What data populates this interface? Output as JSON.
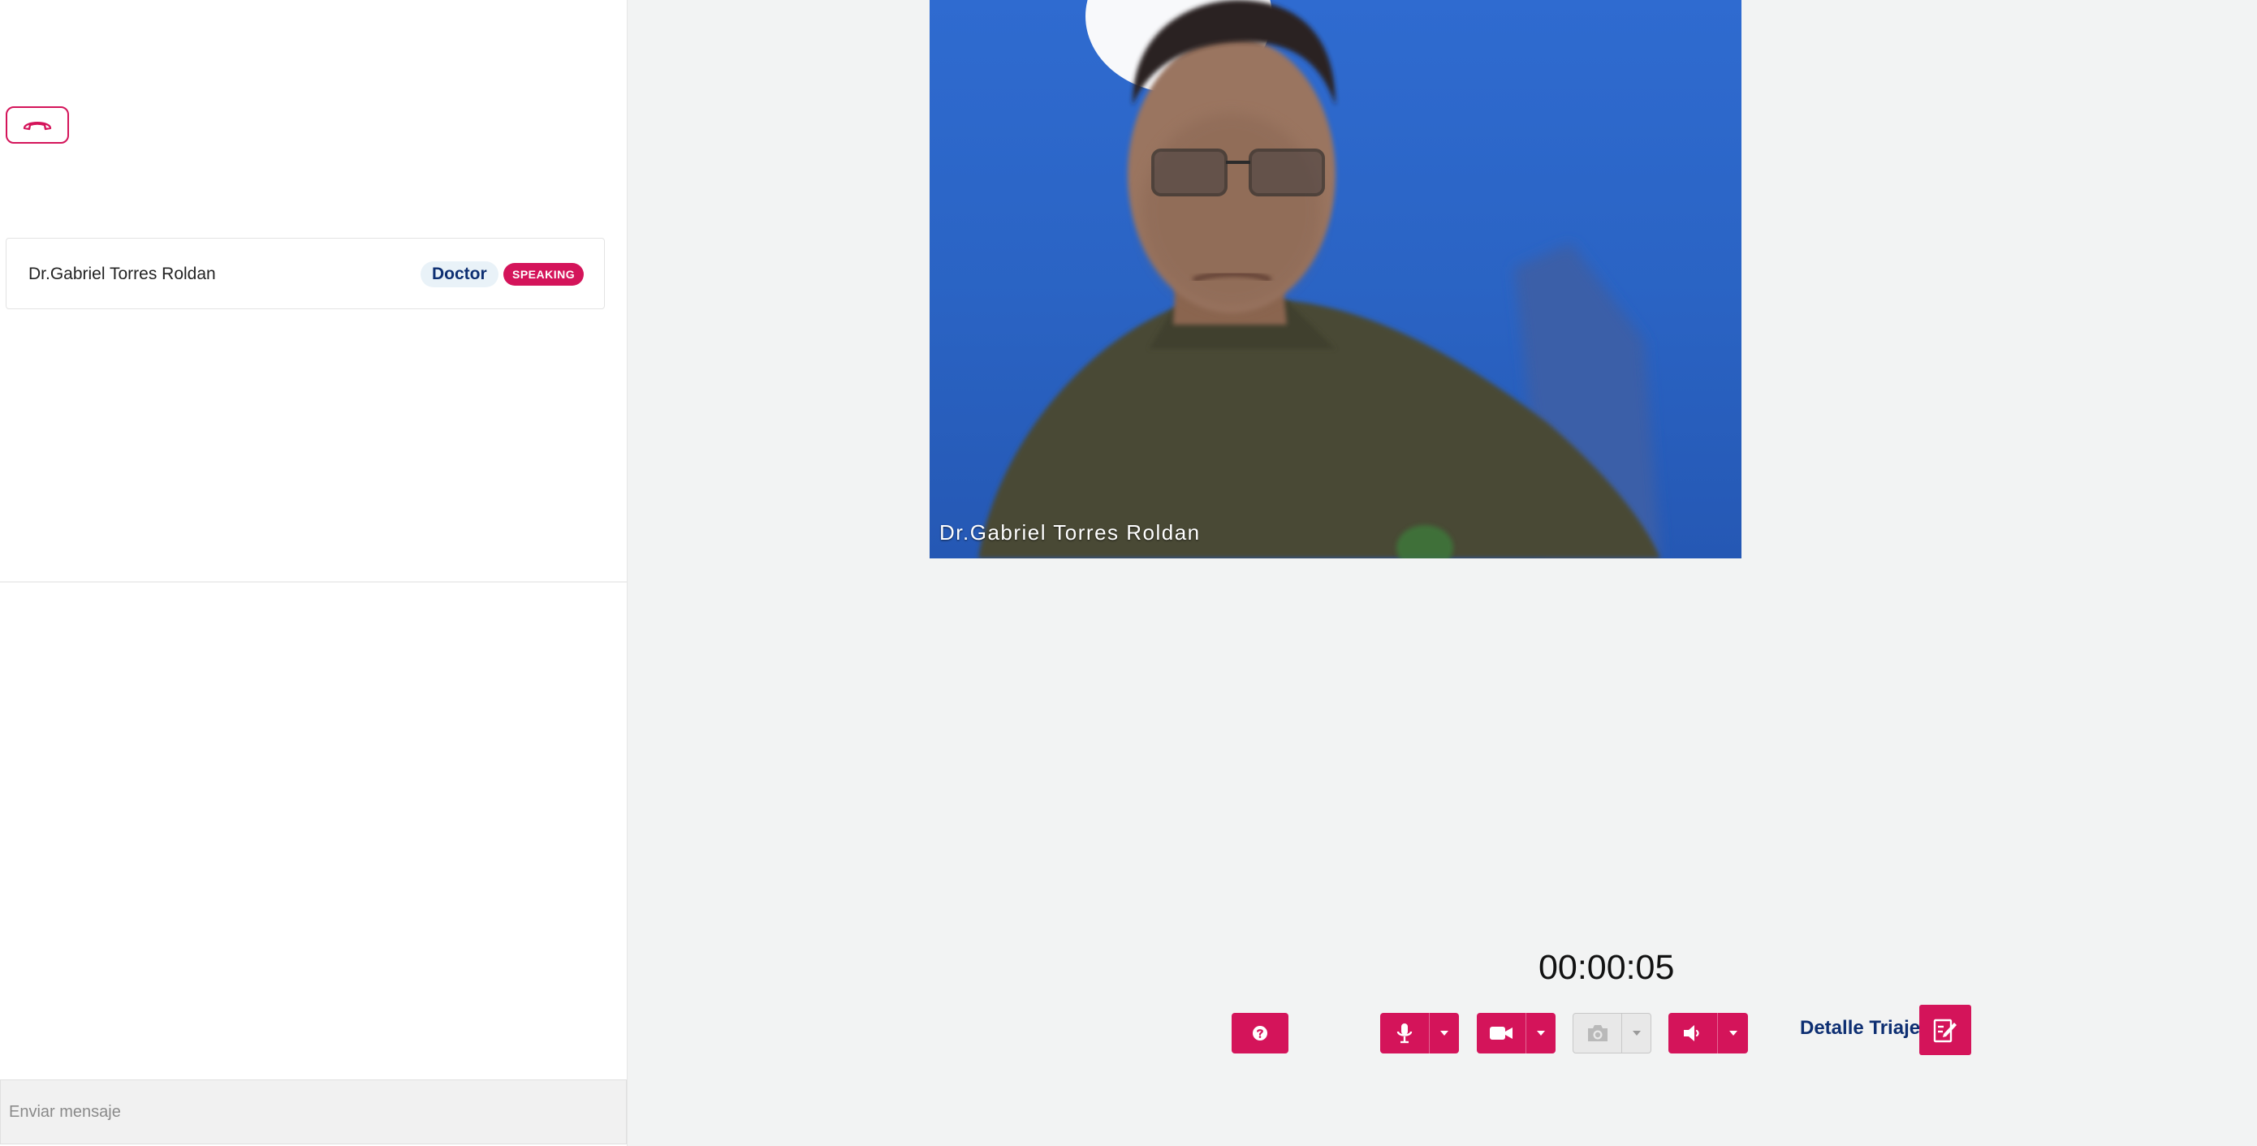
{
  "participants": [
    {
      "name": "Dr.Gabriel Torres Roldan",
      "role": "Doctor",
      "status": "SPEAKING"
    }
  ],
  "video": {
    "name": "Dr.Gabriel Torres Roldan"
  },
  "chat": {
    "placeholder": "Enviar mensaje"
  },
  "call": {
    "timer": "00:00:05"
  },
  "controls": {
    "triage_label": "Detalle Triaje",
    "icons": [
      "phone-hangup-icon",
      "help-icon",
      "microphone-icon",
      "video-camera-icon",
      "camera-icon",
      "speaker-icon",
      "chevron-down-icon",
      "clipboard-edit-icon"
    ]
  },
  "colors": {
    "accent": "#d4145a",
    "navy": "#0e2f72",
    "badge_bg": "#e9f2f8",
    "background": "#f2f3f3"
  }
}
